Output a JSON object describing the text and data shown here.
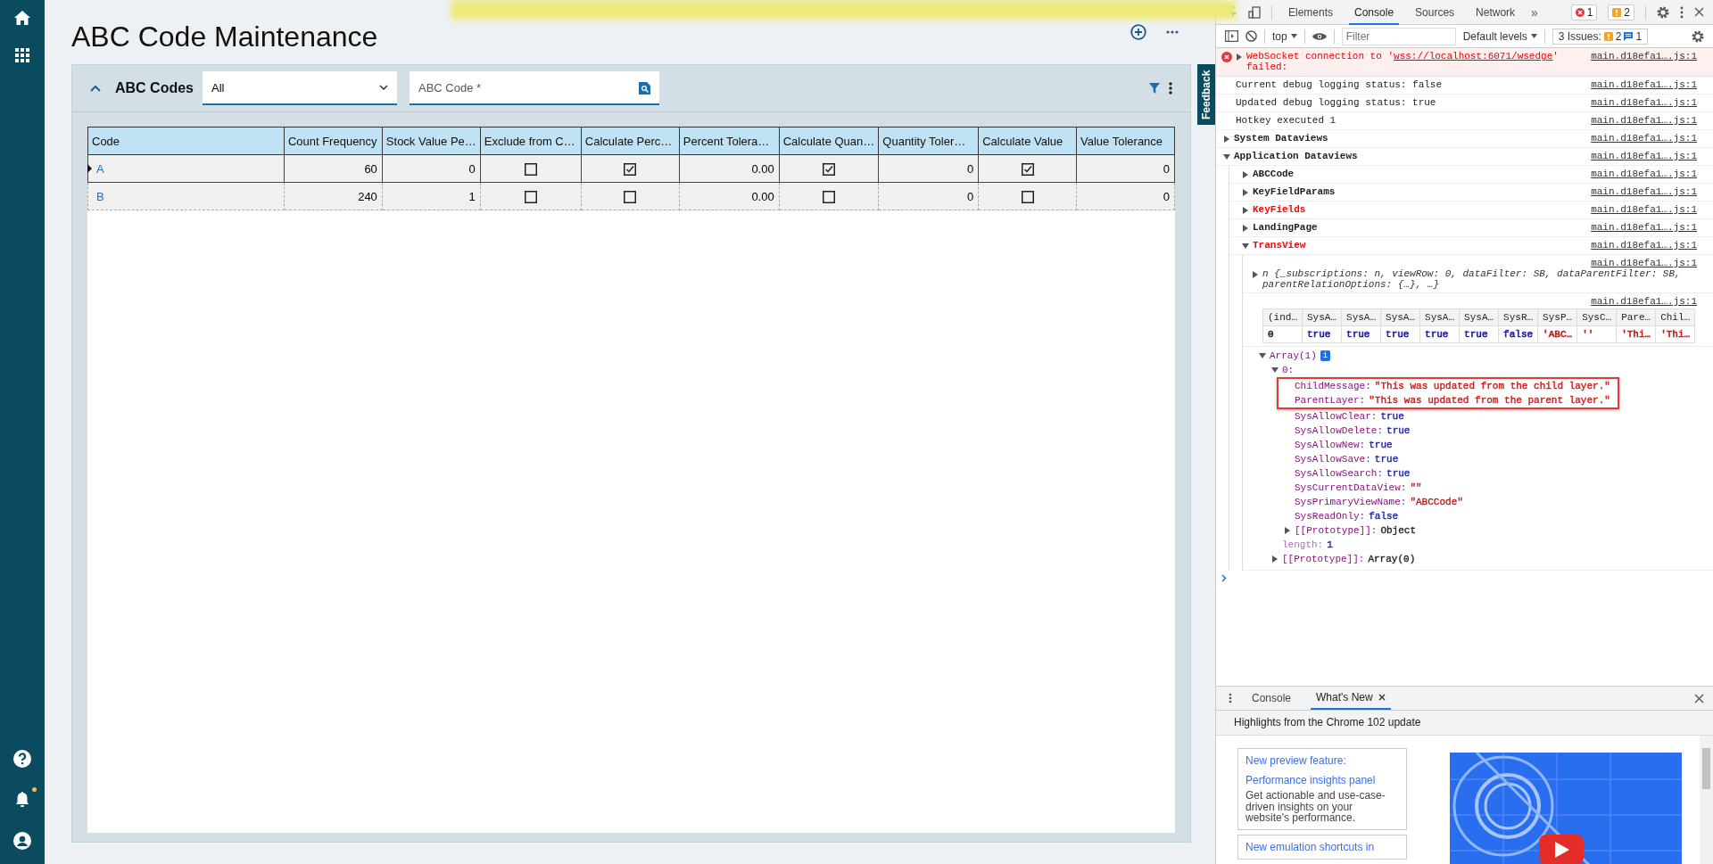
{
  "app": {
    "nav": [
      {
        "kind": "home"
      },
      {
        "kind": "apps"
      }
    ],
    "nav_bottom": [
      {
        "kind": "help",
        "has_notification": false
      },
      {
        "kind": "bell",
        "has_notification": true
      },
      {
        "kind": "user",
        "has_notification": false
      }
    ],
    "title": "ABC Code Maintenance",
    "feedback": "Feedback",
    "panel": {
      "title": "ABC Codes",
      "expanded": true,
      "filter_select": "All",
      "search_placeholder": "ABC Code *"
    },
    "table": {
      "columns": [
        {
          "label": "Code",
          "kind": "link"
        },
        {
          "label": "Count Frequency",
          "kind": "number"
        },
        {
          "label": "Stock Value Pe…",
          "kind": "number"
        },
        {
          "label": "Exclude from C…",
          "kind": "check"
        },
        {
          "label": "Calculate Perc…",
          "kind": "check"
        },
        {
          "label": "Percent Tolera…",
          "kind": "number"
        },
        {
          "label": "Calculate Quan…",
          "kind": "check"
        },
        {
          "label": "Quantity Toler…",
          "kind": "number"
        },
        {
          "label": "Calculate Value",
          "kind": "check"
        },
        {
          "label": "Value Tolerance",
          "kind": "number"
        }
      ],
      "rows": [
        {
          "current": true,
          "cells": [
            "A",
            "60",
            "0",
            false,
            true,
            "0.00",
            true,
            "0",
            true,
            "0"
          ]
        },
        {
          "current": false,
          "cells": [
            "B",
            "240",
            "1",
            false,
            false,
            "0.00",
            false,
            "0",
            false,
            "0"
          ]
        }
      ]
    }
  },
  "devtools": {
    "tabs": [
      {
        "label": "Elements",
        "selected": false
      },
      {
        "label": "Console",
        "selected": true
      },
      {
        "label": "Sources",
        "selected": false
      },
      {
        "label": "Network",
        "selected": false
      }
    ],
    "more_tabs": "»",
    "error_count": "1",
    "warning_count": "2",
    "toolbar": {
      "context": "top",
      "filter_placeholder": "Filter",
      "levels": "Default levels",
      "issues_label": "3 Issues:",
      "issues_warnings": "2",
      "issues_info": "1"
    },
    "console": [
      {
        "kind": "error",
        "expanded": false,
        "prefix": "WebSocket connection to '",
        "link": "wss://localhost:6071/wsedge",
        "suffix": "' failed:",
        "source": "main.d18efa1….js:1"
      },
      {
        "kind": "log",
        "text": "Current debug logging status: false",
        "source": "main.d18efa1….js:1"
      },
      {
        "kind": "log",
        "text": "Updated debug logging status: true",
        "source": "main.d18efa1….js:1"
      },
      {
        "kind": "log",
        "text": "Hotkey executed 1",
        "source": "main.d18efa1….js:1"
      },
      {
        "kind": "group",
        "label": "System Dataviews",
        "expanded": false,
        "color": "#222222",
        "source": "main.d18efa1….js:1"
      },
      {
        "kind": "group",
        "label": "Application Dataviews",
        "expanded": true,
        "color": "#222222",
        "source": "main.d18efa1….js:1",
        "children": [
          {
            "kind": "group",
            "label": "ABCCode",
            "expanded": false,
            "color": "#222222",
            "source": "main.d18efa1….js:1"
          },
          {
            "kind": "group",
            "label": "KeyFieldParams",
            "expanded": false,
            "color": "#222222",
            "source": "main.d18efa1….js:1"
          },
          {
            "kind": "group",
            "label": "KeyFields",
            "expanded": false,
            "color": "#ff0000",
            "source": "main.d18efa1….js:1"
          },
          {
            "kind": "group",
            "label": "LandingPage",
            "expanded": false,
            "color": "#222222",
            "source": "main.d18efa1….js:1"
          },
          {
            "kind": "group",
            "label": "TransView",
            "expanded": true,
            "color": "#ff0000",
            "source": "main.d18efa1….js:1",
            "children": [
              {
                "kind": "object",
                "expanded": false,
                "text": "n {_subscriptions: n, viewRow: 0, dataFilter: SB, dataParentFilter: SB, parentRelationOptions: {…}, …}",
                "source": "main.d18efa1….js:1"
              },
              {
                "kind": "table",
                "source": "main.d18efa1….js:1",
                "columns": [
                  "(ind…",
                  "SysA…",
                  "SysA…",
                  "SysA…",
                  "SysA…",
                  "SysA…",
                  "SysR…",
                  "SysP…",
                  "SysC…",
                  "Pare…",
                  "Chil…"
                ],
                "rows": [
                  [
                    {
                      "text": "0",
                      "color": "#222222"
                    },
                    {
                      "text": "true",
                      "color": "#1a1aa6"
                    },
                    {
                      "text": "true",
                      "color": "#1a1aa6"
                    },
                    {
                      "text": "true",
                      "color": "#1a1aa6"
                    },
                    {
                      "text": "true",
                      "color": "#1a1aa6"
                    },
                    {
                      "text": "true",
                      "color": "#1a1aa6"
                    },
                    {
                      "text": "false",
                      "color": "#1a1aa6"
                    },
                    {
                      "text": "'ABC…",
                      "color": "#c41a16"
                    },
                    {
                      "text": "''",
                      "color": "#c41a16"
                    },
                    {
                      "text": "'Thi…",
                      "color": "#c41a16"
                    },
                    {
                      "text": "'Thi…",
                      "color": "#c41a16"
                    }
                  ]
                ]
              },
              {
                "kind": "tree",
                "nodes": [
                  {
                    "key": "Array(1)",
                    "badge": "i",
                    "expanded": true,
                    "children": [
                      {
                        "key": "0:",
                        "expanded": true,
                        "children": [
                          {
                            "kind": "callout",
                            "children": [
                              {
                                "key": "ChildMessage:",
                                "value": "\"This was updated from the child layer.\"",
                                "color": "#c41a16"
                              },
                              {
                                "key": "ParentLayer:",
                                "value": "\"This was updated from the parent layer.\"",
                                "color": "#c41a16"
                              }
                            ]
                          },
                          {
                            "key": "SysAllowClear:",
                            "value": "true",
                            "color": "#1a1aa6"
                          },
                          {
                            "key": "SysAllowDelete:",
                            "value": "true",
                            "color": "#1a1aa6"
                          },
                          {
                            "key": "SysAllowNew:",
                            "value": "true",
                            "color": "#1a1aa6"
                          },
                          {
                            "key": "SysAllowSave:",
                            "value": "true",
                            "color": "#1a1aa6"
                          },
                          {
                            "key": "SysAllowSearch:",
                            "value": "true",
                            "color": "#1a1aa6"
                          },
                          {
                            "key": "SysCurrentDataView:",
                            "value": "\"\"",
                            "color": "#c41a16"
                          },
                          {
                            "key": "SysPrimaryViewName:",
                            "value": "\"ABCCode\"",
                            "color": "#c41a16"
                          },
                          {
                            "key": "SysReadOnly:",
                            "value": "false",
                            "color": "#1a1aa6"
                          },
                          {
                            "key": "[[Prototype]]:",
                            "value": "Object",
                            "color": "#222222",
                            "expanded": false
                          }
                        ]
                      },
                      {
                        "key": "length:",
                        "value": "1",
                        "color": "#1a1aa6",
                        "dim": true
                      },
                      {
                        "key": "[[Prototype]]:",
                        "value": "Array(0)",
                        "color": "#222222",
                        "expanded": false
                      }
                    ]
                  }
                ]
              }
            ]
          }
        ]
      }
    ],
    "drawer": {
      "tabs": [
        {
          "label": "Console",
          "selected": false,
          "closable": false
        },
        {
          "label": "What's New",
          "selected": true,
          "closable": true
        }
      ],
      "heading": "Highlights from the Chrome 102 update",
      "cards": [
        {
          "title": "New preview feature:",
          "subtitle": "Performance insights panel",
          "body": "Get actionable and use-case-driven insights on your website's performance."
        },
        {
          "title": "New emulation shortcuts in"
        }
      ]
    }
  }
}
